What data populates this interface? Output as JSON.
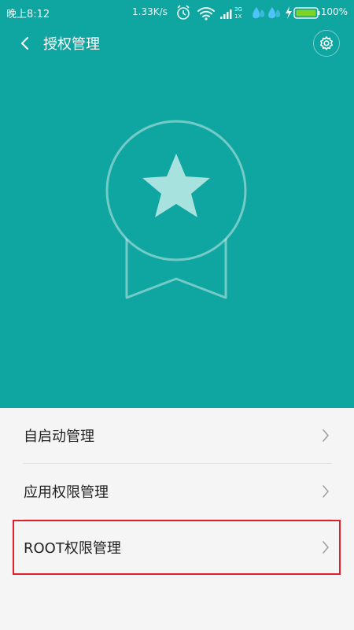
{
  "status_bar": {
    "time": "晚上8:12",
    "network_speed": "1.33K/s",
    "battery_percent": "100%",
    "icons": [
      "alarm-icon",
      "wifi-icon",
      "signal-3g-1x-icon",
      "drop-icon",
      "drop-icon",
      "charging-icon",
      "battery-icon"
    ]
  },
  "header": {
    "title": "授权管理",
    "back_icon": "chevron-left-icon",
    "settings_icon": "gear-icon"
  },
  "hero": {
    "icon": "award-badge-icon"
  },
  "menu": {
    "items": [
      {
        "label": "自启动管理",
        "icon": "chevron-right-icon"
      },
      {
        "label": "应用权限管理",
        "icon": "chevron-right-icon"
      },
      {
        "label": "ROOT权限管理",
        "icon": "chevron-right-icon"
      }
    ]
  },
  "colors": {
    "primary": "#0fa5a0",
    "highlight_border": "#e01f2a",
    "battery": "#7ed321"
  }
}
